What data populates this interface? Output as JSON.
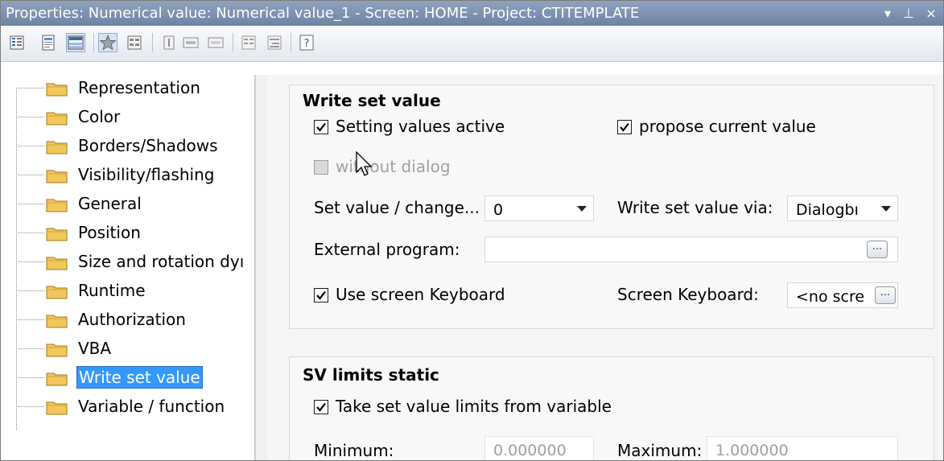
{
  "window": {
    "title": "Properties: Numerical value: Numerical value_1 - Screen: HOME - Project: CTITEMPLATE",
    "controls": [
      "▾",
      "⊥",
      "×"
    ]
  },
  "toolbar": {
    "icons": [
      "list-view-icon",
      "properties-page-icon",
      "grouped-view-icon",
      "favorites-star-icon",
      "static-properties-icon",
      "dynamic-properties-icon",
      "expand-all-icon",
      "collapse-all-icon",
      "sort-by-category-icon",
      "sort-alphabetical-icon",
      "help-icon"
    ]
  },
  "tree": {
    "items": [
      {
        "label": "Representation"
      },
      {
        "label": "Color"
      },
      {
        "label": "Borders/Shadows"
      },
      {
        "label": "Visibility/flashing"
      },
      {
        "label": "General"
      },
      {
        "label": "Position"
      },
      {
        "label": "Size and rotation dyı"
      },
      {
        "label": "Runtime"
      },
      {
        "label": "Authorization"
      },
      {
        "label": "VBA"
      },
      {
        "label": "Write set value"
      },
      {
        "label": "Variable / function"
      }
    ],
    "selected": "Write set value"
  },
  "write_set_value": {
    "title": "Write set value",
    "setting_values_active": {
      "label": "Setting values active",
      "checked": true
    },
    "propose_current_value": {
      "label": "propose current value",
      "checked": true
    },
    "without_dialog": {
      "label": "without dialog",
      "checked": false,
      "disabled": true
    },
    "set_value_change": {
      "label": "Set value / change...",
      "value": "0"
    },
    "write_via": {
      "label": "Write set value via:",
      "value": "Dialogbı"
    },
    "external_program": {
      "label": "External program:",
      "value": "",
      "button": "..."
    },
    "use_screen_keyboard": {
      "label": "Use screen Keyboard",
      "checked": true
    },
    "screen_keyboard": {
      "label": "Screen Keyboard:",
      "value": "<no scre",
      "button": "..."
    }
  },
  "sv_limits_static": {
    "title": "SV limits static",
    "take_limits": {
      "label": "Take set value limits from variable",
      "checked": true
    },
    "minimum": {
      "label": "Minimum:",
      "value": "0.000000"
    },
    "maximum": {
      "label": "Maximum:",
      "value": "1.000000"
    }
  },
  "colors": {
    "title_bar": "#7b91b0",
    "selection": "#3399ff",
    "folder": "#f2c75c"
  }
}
